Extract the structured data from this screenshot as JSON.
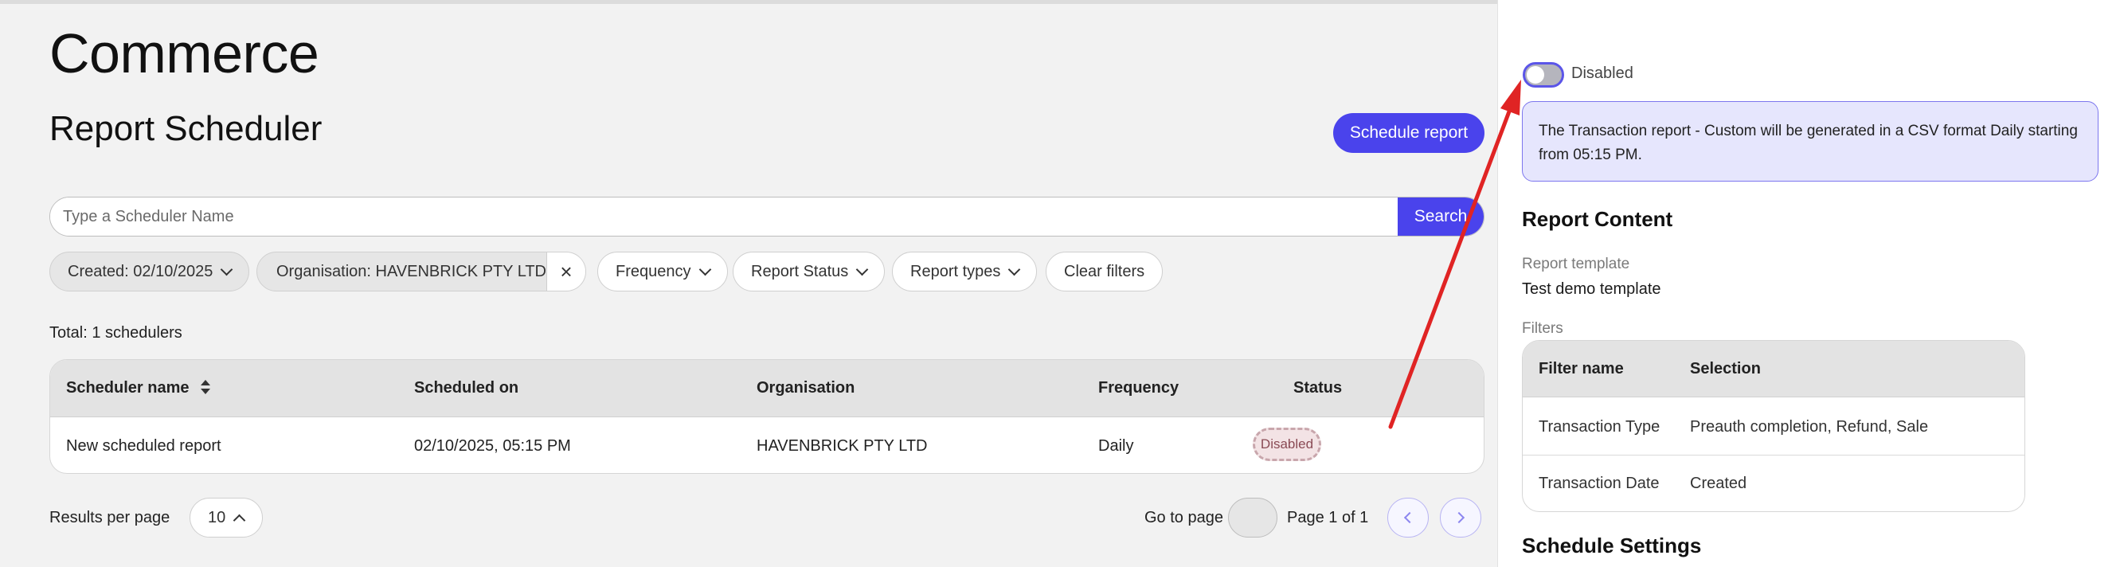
{
  "app": {
    "title": "Commerce"
  },
  "page": {
    "title": "Report Scheduler",
    "schedule_button": "Schedule report"
  },
  "search": {
    "placeholder": "Type a Scheduler Name",
    "value": "",
    "button": "Search"
  },
  "filters": {
    "created": "Created: 02/10/2025",
    "organisation": "Organisation: HAVENBRICK PTY LTD",
    "clear_icon": "×",
    "frequency": "Frequency",
    "report_status": "Report Status",
    "report_types": "Report types",
    "clear_filters": "Clear filters"
  },
  "total": "Total: 1 schedulers",
  "table": {
    "headers": [
      "Scheduler name",
      "Scheduled on",
      "Organisation",
      "Frequency",
      "Status"
    ],
    "rows": [
      {
        "name": "New scheduled report",
        "scheduled_on": "02/10/2025, 05:15 PM",
        "organisation": "HAVENBRICK PTY LTD",
        "frequency": "Daily",
        "status": "Disabled"
      }
    ]
  },
  "pagination": {
    "results_per_page_label": "Results per page",
    "results_per_page": "10",
    "go_to_page_label": "Go to page",
    "go_to_page_value": "",
    "page_info": "Page 1 of 1"
  },
  "side_panel": {
    "toggle_label": "Disabled",
    "toggle_on": false,
    "info_text": "The Transaction report - Custom will be generated in a CSV format Daily starting from 05:15 PM.",
    "report_content_title": "Report Content",
    "report_template_label": "Report template",
    "report_template_value": "Test demo template",
    "filters_label": "Filters",
    "filter_headers": [
      "Filter name",
      "Selection"
    ],
    "filter_rows": [
      {
        "name": "Transaction Type",
        "selection": "Preauth completion, Refund, Sale"
      },
      {
        "name": "Transaction Date",
        "selection": "Created"
      }
    ],
    "schedule_settings_title": "Schedule Settings"
  },
  "colors": {
    "primary": "#4a43ec",
    "annotation_arrow": "#e02424",
    "disabled_badge_bg": "#f3e3e5",
    "info_bg": "#e6e6fd"
  }
}
